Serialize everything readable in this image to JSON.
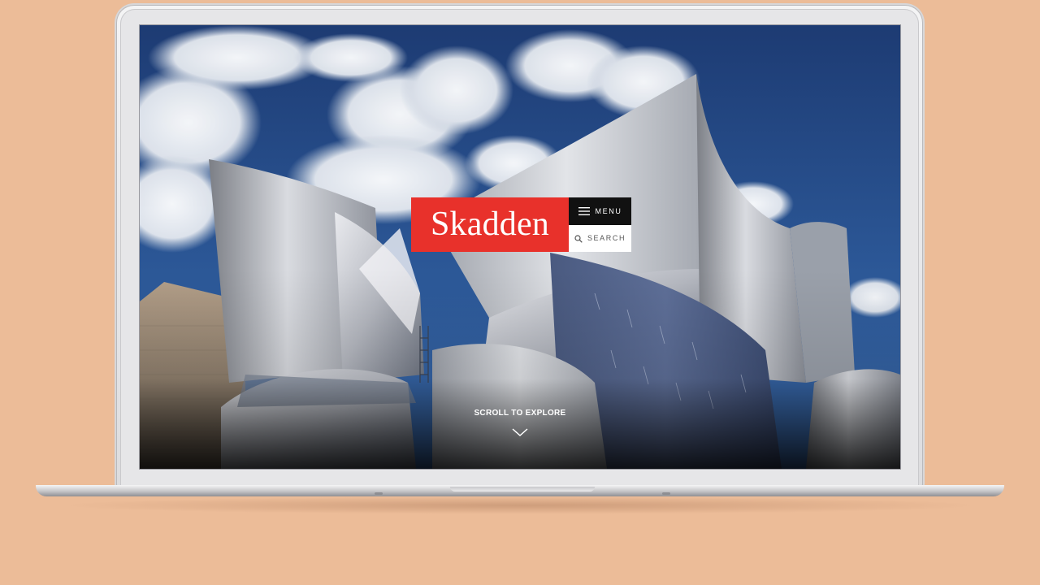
{
  "page": {
    "background_color": "#ecbc98"
  },
  "site": {
    "brand": "Skadden",
    "brand_color": "#e8312b",
    "menu_label": "MENU",
    "menu_icon": "hamburger-icon",
    "search_label": "SEARCH",
    "search_icon": "search-icon",
    "scroll_label": "SCROLL TO EXPLORE",
    "scroll_icon": "chevron-down-icon"
  }
}
